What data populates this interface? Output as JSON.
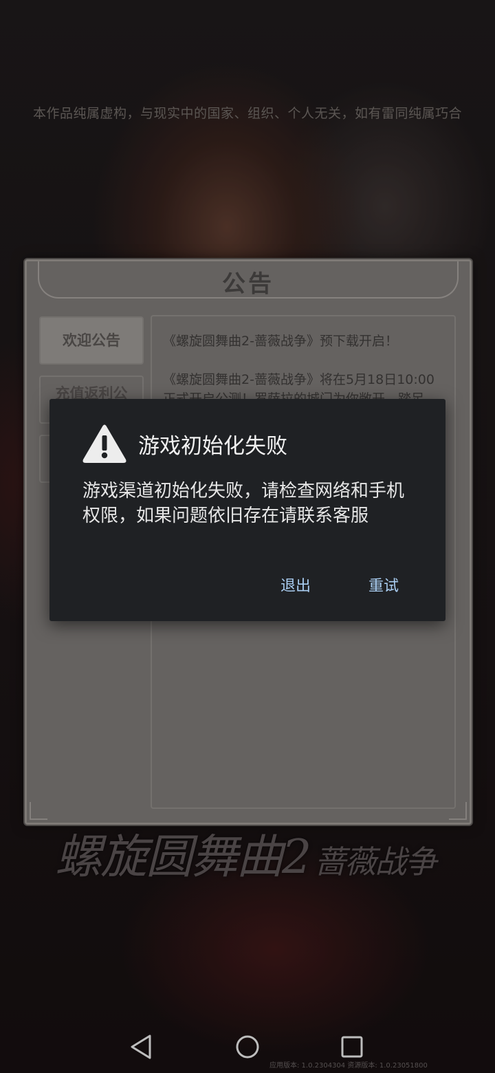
{
  "disclaimer": "本作品纯属虚构，与现实中的国家、组织、个人无关，如有雷同纯属巧合",
  "announcement": {
    "title": "公告",
    "tabs": [
      {
        "label": "欢迎公告",
        "active": true
      },
      {
        "label": "充值返利公",
        "active": false
      },
      {
        "label": "",
        "active": false
      }
    ],
    "paragraphs": [
      "《螺旋圆舞曲2-蔷薇战争》预下载开启！",
      "《螺旋圆舞曲2-蔷薇战争》将在5月18日10:00正式开启公测！罗萨拉的城门为你敞开，踏足"
    ]
  },
  "game_logo": {
    "main": "螺旋圆舞曲2",
    "sub": "蔷薇战争"
  },
  "dialog": {
    "title": "游戏初始化失败",
    "message": "游戏渠道初始化失败，请检查网络和手机权限，如果问题依旧存在请联系客服",
    "buttons": {
      "exit": "退出",
      "retry": "重试"
    },
    "icon": "warning-triangle-icon",
    "accent_color": "#a9cdf1"
  },
  "navbar": {
    "icons": [
      "back-triangle-icon",
      "home-circle-icon",
      "recent-square-icon"
    ]
  },
  "version_text": "应用版本: 1.0.2304304 资源版本: 1.0.23051800"
}
